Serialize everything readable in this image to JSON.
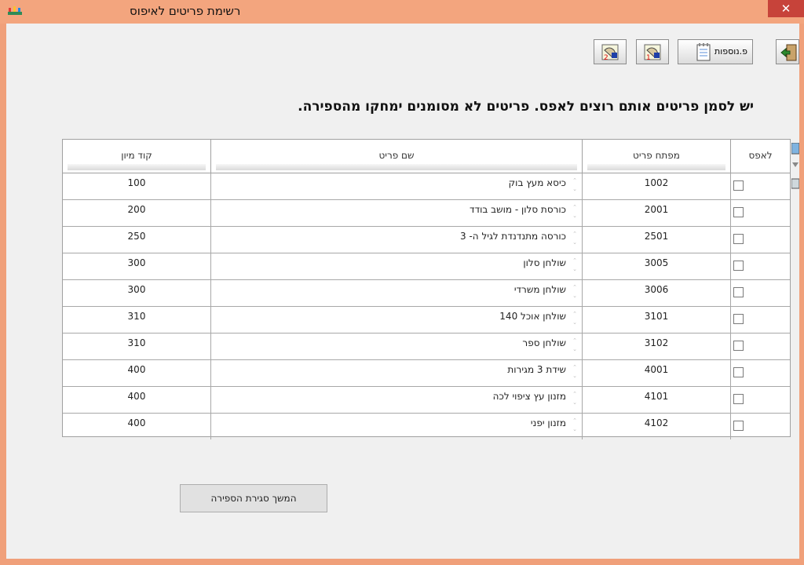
{
  "window": {
    "title": "רשימת פריטים לאיפוס",
    "close_glyph": "✕"
  },
  "toolbar": {
    "extras_label": "פ.נוספות"
  },
  "instruction": "יש לסמן פריטים אותם רוצים לאפס. פריטים לא מסומנים ימחקו מהספירה.",
  "table": {
    "columns": [
      "קוד מיון",
      "שם פריט",
      "מפתח פריט",
      "לאפס"
    ],
    "rows": [
      {
        "sort_code": "100",
        "name": "כיסא מעץ בוק",
        "key": "1002",
        "checked": false
      },
      {
        "sort_code": "200",
        "name": "כורסת סלון - מושב בודד",
        "key": "2001",
        "checked": false
      },
      {
        "sort_code": "250",
        "name": "כורסה מתנדנדת לגיל ה- 3",
        "key": "2501",
        "checked": false
      },
      {
        "sort_code": "300",
        "name": "שולחן סלון",
        "key": "3005",
        "checked": false
      },
      {
        "sort_code": "300",
        "name": "שולחן משרדי",
        "key": "3006",
        "checked": false
      },
      {
        "sort_code": "310",
        "name": "שולחן אוכל 140",
        "key": "3101",
        "checked": false
      },
      {
        "sort_code": "310",
        "name": "שולחן ספר",
        "key": "3102",
        "checked": false
      },
      {
        "sort_code": "400",
        "name": "שידת 3 מגירות",
        "key": "4001",
        "checked": false
      },
      {
        "sort_code": "400",
        "name": "מזנון עץ ציפוי לכה",
        "key": "4101",
        "checked": false
      },
      {
        "sort_code": "400",
        "name": "מזנון יפני",
        "key": "4102",
        "checked": false
      }
    ]
  },
  "continue_button": "המשך סגירת הספירה"
}
